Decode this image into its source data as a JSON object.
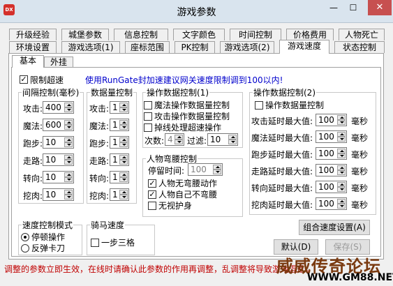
{
  "window": {
    "title": "游戏参数",
    "app_icon": "DX",
    "min": "—",
    "max": "☐",
    "close": "✕"
  },
  "tabs_row1": [
    "升级经验",
    "城堡参数",
    "信息控制",
    "文字颜色",
    "时间控制",
    "价格费用",
    "人物死亡"
  ],
  "tabs_row2": [
    "环境设置",
    "游戏选项(1)",
    "座标范围",
    "PK控制",
    "游戏选项(2)",
    "游戏速度",
    "状态控制"
  ],
  "subtabs": [
    "基本",
    "外挂"
  ],
  "limit_speed": {
    "label": "限制超速",
    "checked": true
  },
  "notice": "使用RunGate封加速建议网关速度限制调到100以内!",
  "interval": {
    "title": "间隔控制(毫秒)",
    "rows": [
      {
        "label": "攻击:",
        "value": "400"
      },
      {
        "label": "魔法:",
        "value": "600"
      },
      {
        "label": "跑步:",
        "value": "10"
      },
      {
        "label": "走路:",
        "value": "10"
      },
      {
        "label": "转向:",
        "value": "10"
      },
      {
        "label": "挖肉:",
        "value": "10"
      }
    ]
  },
  "count": {
    "title": "数据量控制",
    "rows": [
      {
        "label": "攻击:",
        "value": "1"
      },
      {
        "label": "魔法:",
        "value": "1"
      },
      {
        "label": "跑步:",
        "value": "1"
      },
      {
        "label": "走路:",
        "value": "1"
      },
      {
        "label": "转向:",
        "value": "1"
      },
      {
        "label": "挖肉:",
        "value": "1"
      }
    ]
  },
  "op1": {
    "title": "操作数据控制(1)",
    "checks": [
      "魔法操作数据量控制",
      "攻击操作数据量控制",
      "掉线处理超速操作"
    ],
    "times_label": "次数:",
    "times_value": "4",
    "filter_label": "过滤:",
    "filter_value": "10"
  },
  "bow": {
    "title": "人物弯腰控制",
    "stay_label": "停留时间:",
    "stay_value": "100",
    "checks": [
      {
        "label": "人物无弯腰动作",
        "checked": true
      },
      {
        "label": "人物自己不弯腰",
        "checked": true
      },
      {
        "label": "无视护身",
        "checked": false
      }
    ]
  },
  "op2": {
    "title": "操作数据控制(2)",
    "check": "操作数据量控制",
    "unit": "毫秒",
    "rows": [
      {
        "label": "攻击延时最大值:",
        "value": "100"
      },
      {
        "label": "魔法延时最大值:",
        "value": "100"
      },
      {
        "label": "跑步延时最大值:",
        "value": "100"
      },
      {
        "label": "走路延时最大值:",
        "value": "100"
      },
      {
        "label": "转向延时最大值:",
        "value": "100"
      },
      {
        "label": "挖肉延时最大值:",
        "value": "100"
      }
    ]
  },
  "mode": {
    "title": "速度控制模式",
    "options": [
      "停顿操作",
      "反弹卡刀"
    ],
    "selected": 0
  },
  "ride": {
    "title": "骑马速度",
    "check": "一步三格"
  },
  "buttons": {
    "combo": "组合速度设置(A)",
    "default": "默认(D)",
    "save": "保存(S)"
  },
  "status_text": "调整的参数立即生效，在线时请确认此参数的作用再调整，乱调整将导致游戏混乱。",
  "watermark": {
    "line1": "威威传奇论坛",
    "line2": "WWW.GM88.NET"
  }
}
